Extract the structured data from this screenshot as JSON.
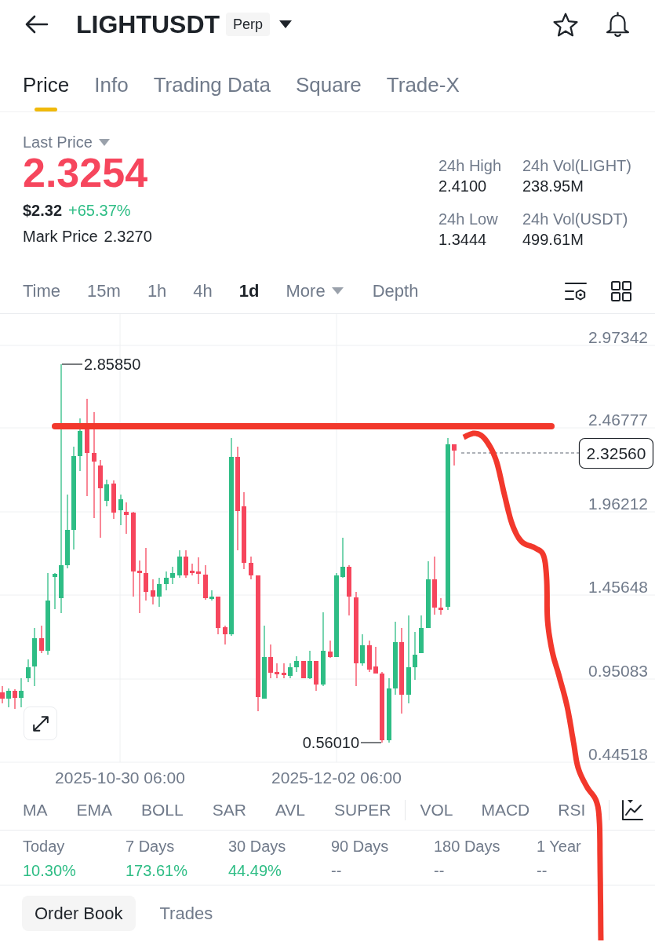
{
  "header": {
    "symbol": "LIGHTUSDT",
    "contract_badge": "Perp"
  },
  "tabs": [
    {
      "label": "Price",
      "selected": true
    },
    {
      "label": "Info",
      "selected": false
    },
    {
      "label": "Trading Data",
      "selected": false
    },
    {
      "label": "Square",
      "selected": false
    },
    {
      "label": "Trade-X",
      "selected": false
    }
  ],
  "price": {
    "label": "Last Price",
    "last_price": "2.3254",
    "last_price_falling": true,
    "usd_price": "$2.32",
    "change": "+65.37%",
    "change_rising": true,
    "mark_price_label": "Mark Price",
    "mark_price": "2.3270"
  },
  "stats": [
    {
      "label": "24h High",
      "value": "2.4100"
    },
    {
      "label": "24h Vol(LIGHT)",
      "value": "238.95M"
    },
    {
      "label": "24h Low",
      "value": "1.3444"
    },
    {
      "label": "24h Vol(USDT)",
      "value": "499.61M"
    }
  ],
  "intervals": [
    {
      "label": "Time",
      "kind": "option",
      "selected": false
    },
    {
      "label": "15m",
      "kind": "option",
      "selected": false
    },
    {
      "label": "1h",
      "kind": "option",
      "selected": false
    },
    {
      "label": "4h",
      "kind": "option",
      "selected": false
    },
    {
      "label": "1d",
      "kind": "option",
      "selected": true
    },
    {
      "label": "More",
      "kind": "menu",
      "selected": false
    },
    {
      "label": "Depth",
      "kind": "option",
      "selected": false
    }
  ],
  "chart": {
    "y_axis_labels": [
      "2.97342",
      "2.46777",
      "1.96212",
      "1.45648",
      "0.95083",
      "0.44518"
    ],
    "x_axis_labels": [
      "2025-10-30 06:00",
      "2025-12-02 06:00"
    ],
    "high_marker": "2.85850",
    "low_marker": "0.56010",
    "last_price_tag": "2.32560"
  },
  "main_indicators": [
    "MA",
    "EMA",
    "BOLL",
    "SAR",
    "AVL",
    "SUPER"
  ],
  "sub_indicators": [
    "VOL",
    "MACD",
    "RSI"
  ],
  "performance": [
    {
      "label": "Today",
      "value": "10.30%",
      "color": "#2ebd85"
    },
    {
      "label": "7 Days",
      "value": "173.61%",
      "color": "#2ebd85"
    },
    {
      "label": "30 Days",
      "value": "44.49%",
      "color": "#2ebd85"
    },
    {
      "label": "90 Days",
      "value": "--",
      "color": "#707a8a"
    },
    {
      "label": "180 Days",
      "value": "--",
      "color": "#707a8a"
    },
    {
      "label": "1 Year",
      "value": "--",
      "color": "#707a8a"
    }
  ],
  "bottom_tabs": [
    {
      "label": "Order Book",
      "selected": true
    },
    {
      "label": "Trades",
      "selected": false
    }
  ]
}
